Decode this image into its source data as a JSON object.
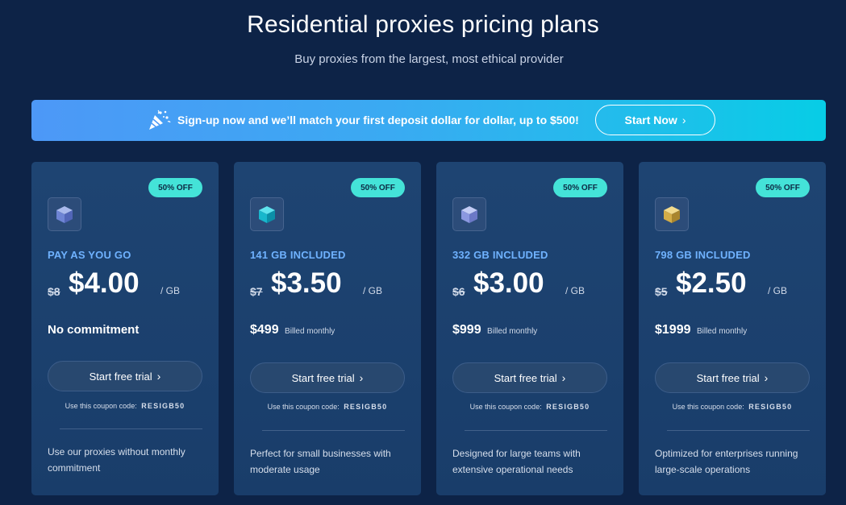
{
  "header": {
    "title": "Residential proxies pricing plans",
    "subtitle": "Buy proxies from the largest, most ethical provider"
  },
  "promo": {
    "icon": "party-popper-icon",
    "text": "Sign-up now and we’ll match your first deposit dollar for dollar, up to $500!",
    "button_label": "Start Now",
    "chevron": "›"
  },
  "colors": {
    "background": "#0d2347",
    "card": "#1e4472",
    "badge": "#44e3d8",
    "plan_name": "#6fb2ff",
    "promo_gradient_start": "#4d98f7",
    "promo_gradient_end": "#07cde6"
  },
  "plans": [
    {
      "badge": "50% OFF",
      "icon": "cube-icon",
      "cube_color": "blue",
      "name": "PAY AS YOU GO",
      "old_price": "$8",
      "price": "$4.00",
      "unit": "/ GB",
      "commitment": "No commitment",
      "button_label": "Start free trial",
      "chevron": "›",
      "coupon_label": "Use this coupon code:",
      "coupon_code": "RESIGB50",
      "description": "Use our proxies without monthly commitment"
    },
    {
      "badge": "50% OFF",
      "icon": "cube-icon",
      "cube_color": "teal",
      "name": "141 GB INCLUDED",
      "old_price": "$7",
      "price": "$3.50",
      "unit": "/ GB",
      "billing_amount": "$499",
      "billing_note": "Billed monthly",
      "button_label": "Start free trial",
      "chevron": "›",
      "coupon_label": "Use this coupon code:",
      "coupon_code": "RESIGB50",
      "description": "Perfect for small businesses with moderate usage"
    },
    {
      "badge": "50% OFF",
      "icon": "cube-icon",
      "cube_color": "lavender",
      "name": "332 GB INCLUDED",
      "old_price": "$6",
      "price": "$3.00",
      "unit": "/ GB",
      "billing_amount": "$999",
      "billing_note": "Billed monthly",
      "button_label": "Start free trial",
      "chevron": "›",
      "coupon_label": "Use this coupon code:",
      "coupon_code": "RESIGB50",
      "description": "Designed for large teams with extensive operational needs"
    },
    {
      "badge": "50% OFF",
      "icon": "cube-icon",
      "cube_color": "gold",
      "name": "798 GB INCLUDED",
      "old_price": "$5",
      "price": "$2.50",
      "unit": "/ GB",
      "billing_amount": "$1999",
      "billing_note": "Billed monthly",
      "button_label": "Start free trial",
      "chevron": "›",
      "coupon_label": "Use this coupon code:",
      "coupon_code": "RESIGB50",
      "description": "Optimized for enterprises running large-scale operations"
    }
  ]
}
